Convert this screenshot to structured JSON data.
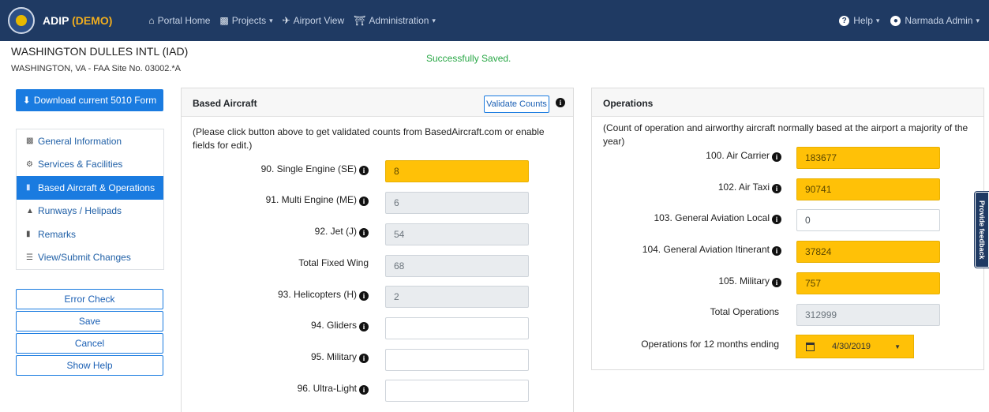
{
  "nav": {
    "brand_name": "ADIP",
    "brand_demo": "(DEMO)",
    "portal_home": "Portal Home",
    "projects": "Projects",
    "airport_view": "Airport View",
    "administration": "Administration",
    "help": "Help",
    "user": "Narmada Admin"
  },
  "header": {
    "title": "WASHINGTON DULLES INTL (IAD)",
    "subtitle": "WASHINGTON, VA - FAA Site No. 03002.*A",
    "status": "Successfully Saved."
  },
  "sidebar": {
    "download_label": "Download current 5010 Form",
    "items": [
      {
        "label": "General Information",
        "icon": "database-icon"
      },
      {
        "label": "Services & Facilities",
        "icon": "cogs-icon"
      },
      {
        "label": "Based Aircraft & Operations",
        "icon": "clipboard-icon"
      },
      {
        "label": "Runways / Helipads",
        "icon": "road-icon"
      },
      {
        "label": "Remarks",
        "icon": "file-icon"
      },
      {
        "label": "View/Submit Changes",
        "icon": "list-icon"
      }
    ],
    "active_index": 2,
    "buttons": {
      "error_check": "Error Check",
      "save": "Save",
      "cancel": "Cancel",
      "show_help": "Show Help"
    }
  },
  "based_aircraft": {
    "title": "Based Aircraft",
    "validate_label": "Validate Counts",
    "note": "(Please click button above to get validated counts from BasedAircraft.com or enable fields for edit.)",
    "fields": [
      {
        "label": "90. Single Engine (SE)",
        "value": "8",
        "state": "highlighted",
        "info": true
      },
      {
        "label": "91. Multi Engine (ME)",
        "value": "6",
        "state": "disabled",
        "info": true
      },
      {
        "label": "92. Jet (J)",
        "value": "54",
        "state": "disabled",
        "info": true
      },
      {
        "label": "Total Fixed Wing",
        "value": "68",
        "state": "disabled",
        "info": false
      },
      {
        "label": "93. Helicopters (H)",
        "value": "2",
        "state": "disabled",
        "info": true
      },
      {
        "label": "94. Gliders",
        "value": "",
        "state": "editable",
        "info": true
      },
      {
        "label": "95. Military",
        "value": "",
        "state": "editable",
        "info": true
      },
      {
        "label": "96. Ultra-Light",
        "value": "",
        "state": "editable",
        "info": true
      }
    ]
  },
  "operations": {
    "title": "Operations",
    "note": "(Count of operation and airworthy aircraft normally based at the airport a majority of the year)",
    "fields": [
      {
        "label": "100. Air Carrier",
        "value": "183677",
        "state": "highlighted",
        "info": true
      },
      {
        "label": "102. Air Taxi",
        "value": "90741",
        "state": "highlighted",
        "info": true
      },
      {
        "label": "103. General Aviation Local",
        "value": "0",
        "state": "editable",
        "info": true
      },
      {
        "label": "104. General Aviation Itinerant",
        "value": "37824",
        "state": "highlighted",
        "info": true
      },
      {
        "label": "105. Military",
        "value": "757",
        "state": "highlighted",
        "info": true
      },
      {
        "label": "Total Operations",
        "value": "312999",
        "state": "disabled",
        "info": false
      }
    ],
    "period_label": "Operations for 12 months ending",
    "period_value": "4/30/2019"
  },
  "feedback": {
    "label": "Provide feedback"
  },
  "colors": {
    "navbar": "#1f3a63",
    "primary": "#1a7be0",
    "highlight": "#ffc107",
    "success": "#28a745",
    "disabled": "#e9ecef"
  }
}
